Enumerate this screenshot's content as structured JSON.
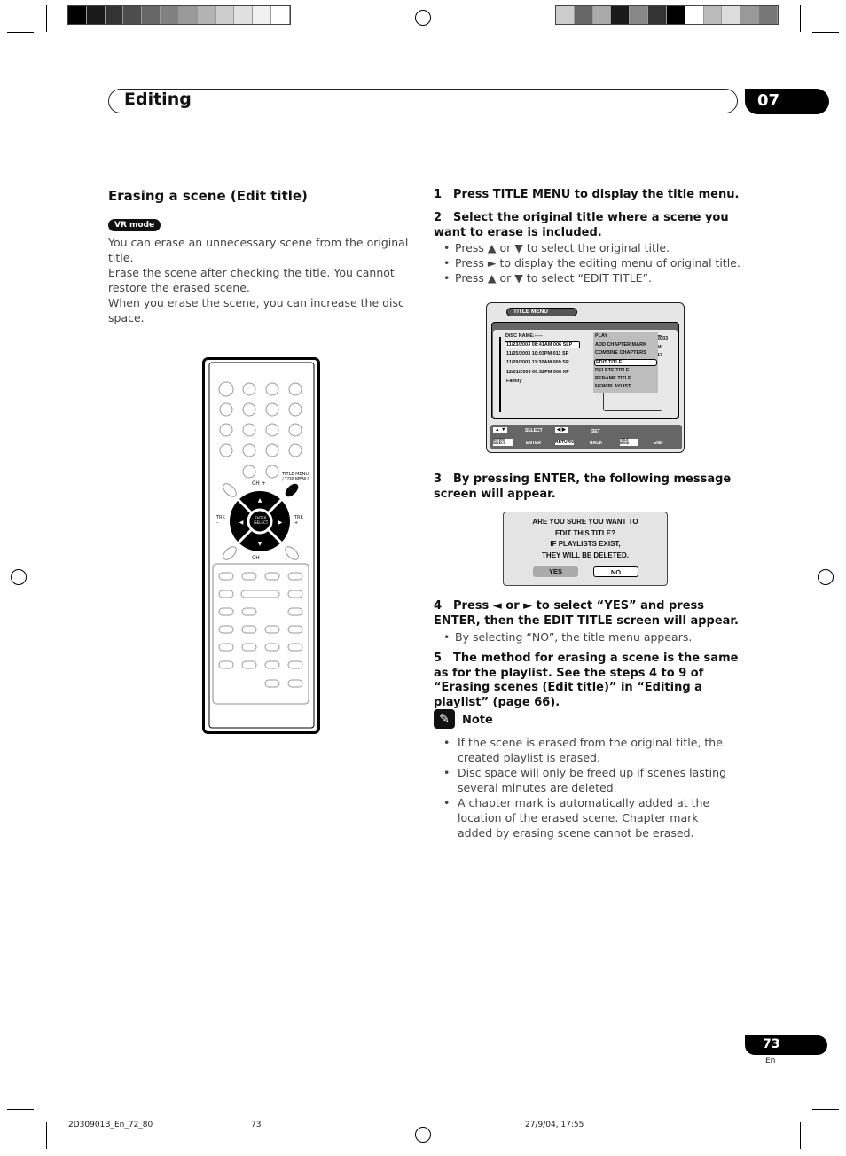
{
  "header": {
    "title": "Editing",
    "chapter": "07"
  },
  "section": {
    "title": "Erasing a scene (Edit title)",
    "badge": "VR mode",
    "intro": [
      "You can erase an unnecessary scene from the original title.",
      "Erase the scene after checking the title. You cannot restore the erased scene.",
      "When you erase the scene, you can increase the disc space."
    ]
  },
  "steps": [
    {
      "num": "1",
      "text": "Press TITLE MENU to display the title menu."
    },
    {
      "num": "2",
      "text": "Select the original title where a scene you want to erase is included.",
      "bullets": [
        "Press ▲ or ▼ to select the original title.",
        "Press ► to display the editing menu of original title.",
        "Press ▲ or ▼ to select “EDIT TITLE”."
      ]
    },
    {
      "num": "3",
      "text": "By pressing ENTER, the following message screen will appear."
    },
    {
      "num": "4",
      "text": "Press ◄ or ► to select “YES” and press ENTER, then the EDIT TITLE screen will appear.",
      "bullets": [
        "By selecting “NO”, the title menu appears."
      ]
    },
    {
      "num": "5",
      "text": "The method for erasing a scene is the same as for the playlist. See the steps 4 to 9 of “Erasing scenes (Edit title)” in “Editing a playlist” (page 66)."
    }
  ],
  "title_menu": {
    "title": "TITLE MENU",
    "disc_name": "DISC NAME:-----",
    "titles": [
      "11/23/2003 08:41AM 006 SLP",
      "11/25/2003 10:03PM 011 SP",
      "11/29/2003 11:30AM 009 SP",
      "12/01/2003 06:52PM 006 XP",
      "Family"
    ],
    "menu": [
      "PLAY",
      "ADD CHAPTER MARK",
      "COMBINE CHAPTERS",
      "EDIT TITLE",
      "DELETE TITLE",
      "RENAME TITLE",
      "NEW PLAYLIST"
    ],
    "info": [
      "2003",
      "M",
      "17"
    ],
    "guide": {
      "select": "SELECT",
      "set": "SET",
      "enter_key": "ENTER/ SELECT",
      "enter": "ENTER",
      "return_key": "RETURN",
      "back": "BACK",
      "title_key": "TITLE MENU",
      "end": "END"
    }
  },
  "dialog": {
    "lines": [
      "ARE YOU SURE YOU WANT TO",
      "EDIT THIS TITLE?",
      "IF PLAYLISTS EXIST,",
      "THEY WILL BE DELETED."
    ],
    "yes": "YES",
    "no": "NO"
  },
  "remote": {
    "title_menu": "TITLE MENU / TOP MENU",
    "ch_plus": "CH +",
    "ch_minus": "CH –",
    "trk_minus": "TRK –",
    "trk_plus": "TRK +",
    "enter": "ENTER /SELECT"
  },
  "note": {
    "title": "Note",
    "items": [
      "If the scene is erased from the original title, the created playlist is erased.",
      "Disc space will only be freed up if scenes lasting several minutes are deleted.",
      "A chapter mark is automatically added at the location of the erased scene. Chapter mark added by erasing scene cannot be erased."
    ]
  },
  "page": {
    "number": "73",
    "lang": "En"
  },
  "footer": {
    "code": "2D30901B_En_72_80",
    "page": "73",
    "date": "27/9/04, 17:55"
  }
}
